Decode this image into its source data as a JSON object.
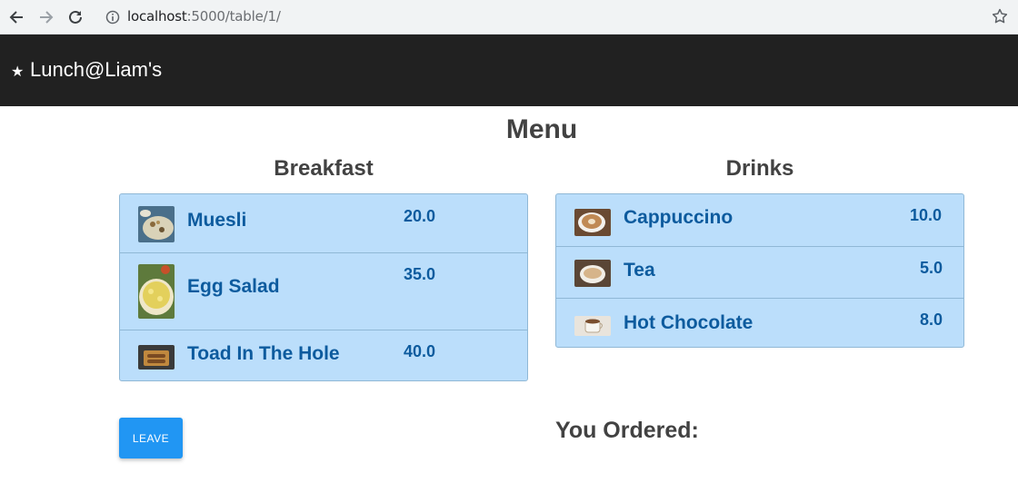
{
  "browser": {
    "url_host": "localhost",
    "url_rest": ":5000/table/1/",
    "icons": [
      "back-arrow-icon",
      "forward-arrow-icon",
      "reload-icon",
      "info-icon",
      "bookmark-star-icon"
    ]
  },
  "app": {
    "title": "Lunch@Liam's",
    "logo_icon": "star-icon",
    "bar_color": "#212121"
  },
  "menu": {
    "title": "Menu",
    "sections": [
      {
        "name": "Breakfast",
        "items": [
          {
            "name": "Muesli",
            "price": "20.0",
            "icon": "muesli-thumbnail"
          },
          {
            "name": "Egg Salad",
            "price": "35.0",
            "icon": "egg-salad-thumbnail"
          },
          {
            "name": "Toad In The Hole",
            "price": "40.0",
            "icon": "toad-in-the-hole-thumbnail"
          }
        ]
      },
      {
        "name": "Drinks",
        "items": [
          {
            "name": "Cappuccino",
            "price": "10.0",
            "icon": "cappuccino-thumbnail"
          },
          {
            "name": "Tea",
            "price": "5.0",
            "icon": "tea-thumbnail"
          },
          {
            "name": "Hot Chocolate",
            "price": "8.0",
            "icon": "hot-chocolate-thumbnail"
          }
        ]
      }
    ]
  },
  "actions": {
    "leave_label": "LEAVE"
  },
  "order": {
    "title": "You Ordered:"
  },
  "colors": {
    "accent": "#2196f3",
    "list_bg": "#bbdefb",
    "item_text": "#0d5b9e"
  }
}
